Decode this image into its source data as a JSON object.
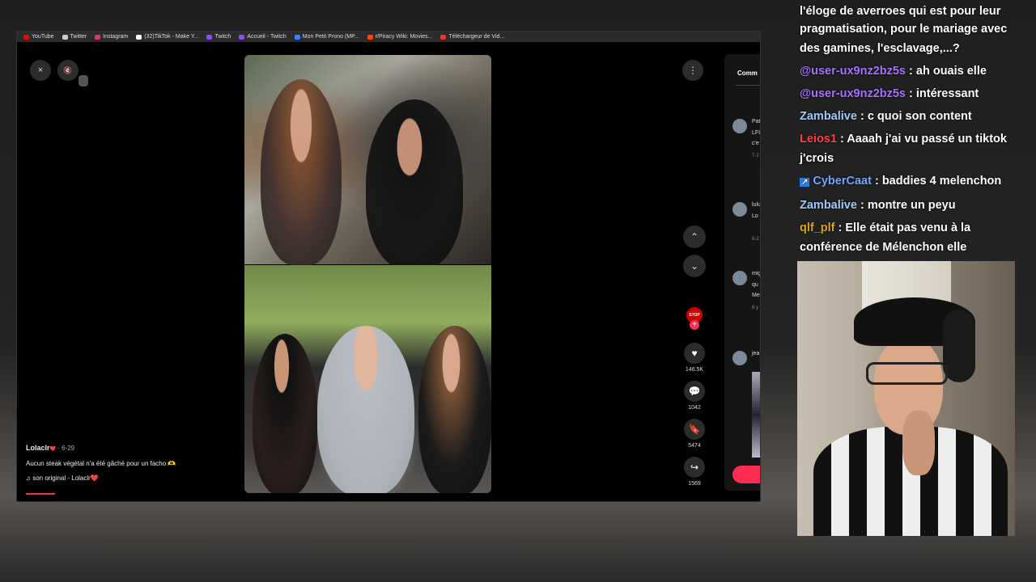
{
  "bookmarks": [
    {
      "label": "YouTube",
      "color": "#ff0000"
    },
    {
      "label": "Twitter",
      "color": "#cccccc"
    },
    {
      "label": "Instagram",
      "color": "#e1306c"
    },
    {
      "label": "(32)TikTok - Make Y...",
      "color": "#ffffff"
    },
    {
      "label": "Twitch",
      "color": "#9146ff"
    },
    {
      "label": "Accueil - Twitch",
      "color": "#9146ff"
    },
    {
      "label": "Mon Petit Prono (MP...",
      "color": "#3b82f6"
    },
    {
      "label": "r/Piracy Wiki: Movies...",
      "color": "#ff4500"
    },
    {
      "label": "Téléchargeur de Vid...",
      "color": "#e53935"
    }
  ],
  "video": {
    "close_icon": "×",
    "mute_icon": "🔇",
    "more_icon": "⋮",
    "nav_up_icon": "⌃",
    "nav_down_icon": "⌄",
    "creator_avatar_text": "STOP",
    "follow_icon": "+"
  },
  "actions": [
    {
      "icon": "♥",
      "name": "like",
      "count": "146.5K"
    },
    {
      "icon": "💬",
      "name": "comment",
      "count": "1042"
    },
    {
      "icon": "🔖",
      "name": "save",
      "count": "5474"
    },
    {
      "icon": "↪",
      "name": "share",
      "count": "1569"
    }
  ],
  "caption": {
    "user": "Lolaclr",
    "heart": "❤️",
    "date": "· 6-29",
    "text": "Aucun steak végétal n'a été gâché pour un facho 🫶",
    "sound": "son original - Lolaclr❤️"
  },
  "comments_panel": {
    "tab_label": "Comm",
    "items": [
      {
        "name": "Pat",
        "line1": "LFI",
        "line2": "c'e",
        "date": "7-2"
      },
      {
        "name": "lulu",
        "line1": "Lo",
        "line2": "",
        "date": "6-2"
      },
      {
        "name": "mig",
        "line1": "qu",
        "line2": "Me",
        "date": "8 y"
      },
      {
        "name": "jea",
        "line1": "",
        "line2": "",
        "date": ""
      }
    ]
  },
  "chat": {
    "cut_text": "l'éloge de averroes qui est pour leur",
    "messages": [
      {
        "name": "",
        "color": "#ffffff",
        "text": "pragmatisation, pour le mariage avec des gamines, l'esclavage,...?",
        "badge": ""
      },
      {
        "name": "@user-ux9nz2bz5s",
        "color": "#a970ff",
        "text": "ah ouais elle",
        "badge": ""
      },
      {
        "name": "@user-ux9nz2bz5s",
        "color": "#a970ff",
        "text": "intéressant",
        "badge": ""
      },
      {
        "name": "Zambalive",
        "color": "#9ecbff",
        "text": "c quoi son content",
        "badge": ""
      },
      {
        "name": "Leios1",
        "color": "#ff4040",
        "text": "Aaaah j'ai vu passé un tiktok j'crois",
        "badge": ""
      },
      {
        "name": "CyberCaat",
        "color": "#6ea8ff",
        "text": "baddies 4 melenchon",
        "badge": "↗"
      },
      {
        "name": "Zambalive",
        "color": "#9ecbff",
        "text": "montre un peyu",
        "badge": ""
      },
      {
        "name": "qlf_plf",
        "color": "#daa520",
        "text": "Elle était pas venu à la conférence de Mélenchon elle",
        "badge": ""
      }
    ]
  }
}
